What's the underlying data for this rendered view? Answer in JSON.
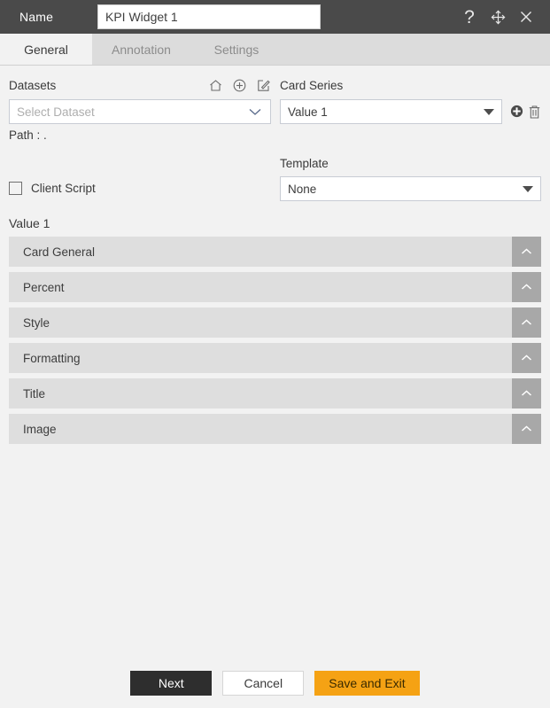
{
  "titlebar": {
    "label": "Name",
    "name_value": "KPI Widget 1",
    "name_placeholder": "",
    "help_icon": "question-mark-icon",
    "move_icon": "move-arrows-icon",
    "close_icon": "close-x-icon"
  },
  "tabs": [
    {
      "label": "General",
      "active": true
    },
    {
      "label": "Annotation",
      "active": false
    },
    {
      "label": "Settings",
      "active": false
    }
  ],
  "datasets": {
    "label": "Datasets",
    "icons": [
      "home-icon",
      "add-circle-icon",
      "edit-square-icon"
    ],
    "select_placeholder": "Select Dataset",
    "path_label": "Path :",
    "path_value": "."
  },
  "card_series": {
    "label": "Card Series",
    "value": "Value 1",
    "add_icon": "add-filled-circle-icon",
    "delete_icon": "trash-icon"
  },
  "client_script": {
    "label": "Client Script",
    "checked": false
  },
  "template": {
    "label": "Template",
    "value": "None"
  },
  "value_section": {
    "heading": "Value 1"
  },
  "accordion": [
    {
      "title": "Card General"
    },
    {
      "title": "Percent"
    },
    {
      "title": "Style"
    },
    {
      "title": "Formatting"
    },
    {
      "title": "Title"
    },
    {
      "title": "Image"
    }
  ],
  "footer": {
    "next": "Next",
    "cancel": "Cancel",
    "save": "Save and Exit"
  },
  "colors": {
    "titlebar_bg": "#4a4a4a",
    "tabbar_bg": "#dcdcdc",
    "page_bg": "#f2f2f2",
    "accordion_bg": "#dedede",
    "accordion_toggle_bg": "#a8a8a8",
    "accent_orange": "#f5a214",
    "next_dark": "#2e2e2e"
  }
}
